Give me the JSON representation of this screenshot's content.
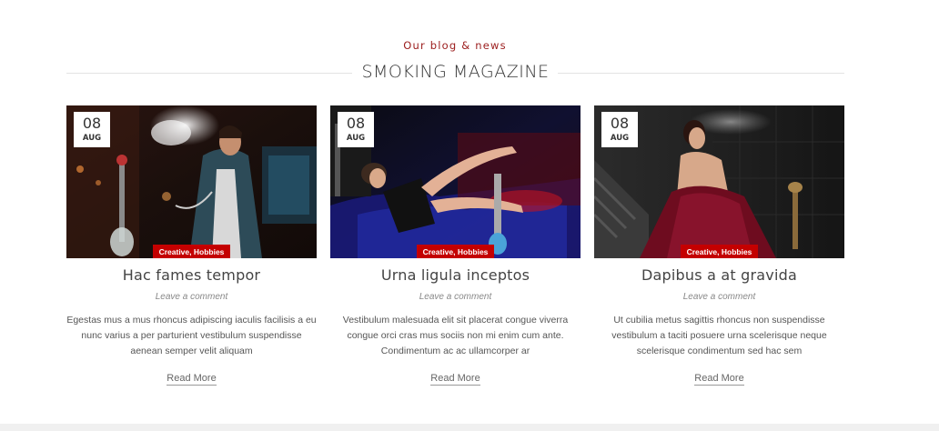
{
  "section": {
    "subtitle": "Our blog & news",
    "title": "SMOKING MAGAZINE"
  },
  "posts": [
    {
      "day": "08",
      "month": "AUG",
      "categories": "Creative, Hobbies",
      "title": "Hac fames tempor",
      "comment_link": "Leave a comment",
      "excerpt": "Egestas mus a mus rhoncus adipiscing iaculis facilisis a eu nunc varius a per parturient vestibulum suspendisse aenean semper velit aliquam",
      "read_more": "Read More",
      "image_icon": "man-smoking-hookah-photo"
    },
    {
      "day": "08",
      "month": "AUG",
      "categories": "Creative, Hobbies",
      "title": "Urna ligula inceptos",
      "comment_link": "Leave a comment",
      "excerpt": "Vestibulum malesuada elit sit placerat congue viverra congue orci cras mus sociis non mi enim cum ante. Condimentum ac ac ullamcorper ar",
      "read_more": "Read More",
      "image_icon": "woman-reclining-hookah-photo"
    },
    {
      "day": "08",
      "month": "AUG",
      "categories": "Creative, Hobbies",
      "title": "Dapibus a at gravida",
      "comment_link": "Leave a comment",
      "excerpt": "Ut cubilia metus sagittis rhoncus non suspendisse vestibulum a taciti posuere urna scelerisque neque scelerisque condimentum sed hac sem",
      "read_more": "Read More",
      "image_icon": "woman-red-dress-hookah-photo"
    }
  ],
  "colors": {
    "accent": "#c40000",
    "subtitle": "#9b1c1c",
    "text": "#333333"
  }
}
